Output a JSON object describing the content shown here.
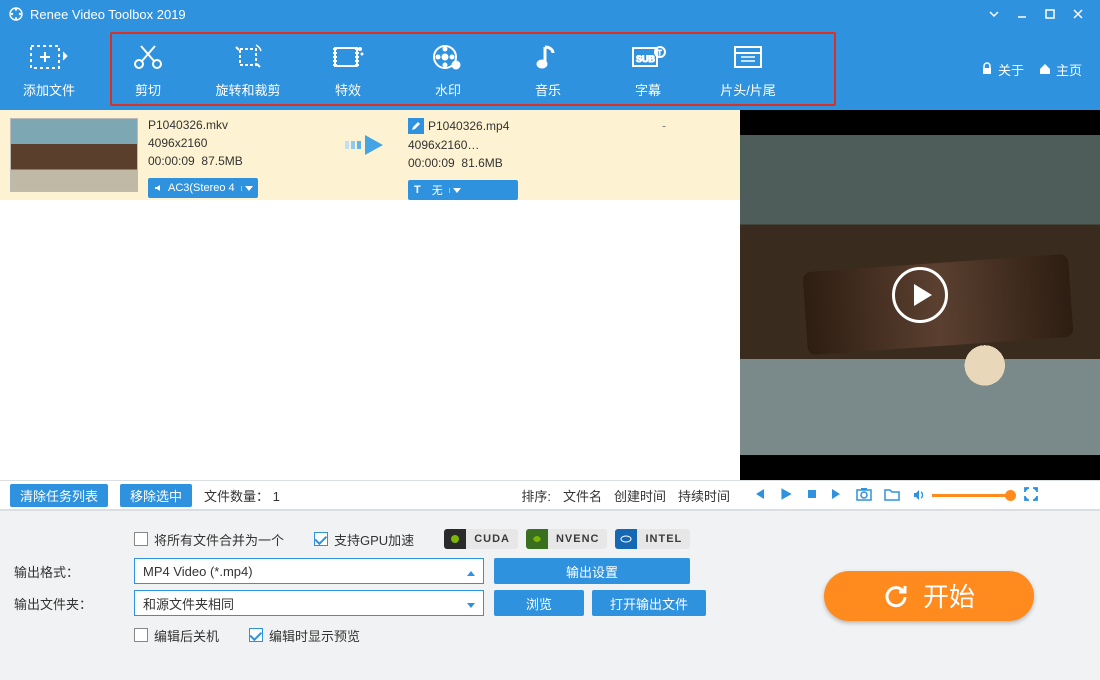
{
  "title": "Renee Video Toolbox 2019",
  "header_links": {
    "about": "关于",
    "home": "主页"
  },
  "toolbar": {
    "add_file": "添加文件",
    "items": [
      {
        "key": "cut",
        "label": "剪切"
      },
      {
        "key": "rotate",
        "label": "旋转和裁剪"
      },
      {
        "key": "effect",
        "label": "特效"
      },
      {
        "key": "water",
        "label": "水印"
      },
      {
        "key": "music",
        "label": "音乐"
      },
      {
        "key": "sub",
        "label": "字幕"
      },
      {
        "key": "intro",
        "label": "片头/片尾"
      }
    ]
  },
  "file": {
    "src": {
      "name": "P1040326.mkv",
      "res": "4096x2160",
      "dur": "00:00:09",
      "size": "87.5MB"
    },
    "dst": {
      "name": "P1040326.mp4",
      "res": "4096x2160…",
      "dur": "00:00:09",
      "size": "81.6MB"
    },
    "audio_drop": "AC3(Stereo 4",
    "sub_drop": "无",
    "dst_extra": "-"
  },
  "listbar": {
    "clear": "清除任务列表",
    "remove": "移除选中",
    "count_label": "文件数量：",
    "count_value": "1",
    "sort_label": "排序:",
    "sort_opts": [
      "文件名",
      "创建时间",
      "持续时间"
    ]
  },
  "settings": {
    "merge": "将所有文件合并为一个",
    "gpu": "支持GPU加速",
    "badges": [
      "CUDA",
      "NVENC",
      "INTEL"
    ],
    "format_lbl": "输出格式：",
    "format_val": "MP4 Video (*.mp4)",
    "output_settings": "输出设置",
    "folder_lbl": "输出文件夹：",
    "folder_val": "和源文件夹相同",
    "browse": "浏览",
    "open_folder": "打开输出文件",
    "shutdown": "编辑后关机",
    "preview_on_edit": "编辑时显示预览"
  },
  "start": "开始"
}
